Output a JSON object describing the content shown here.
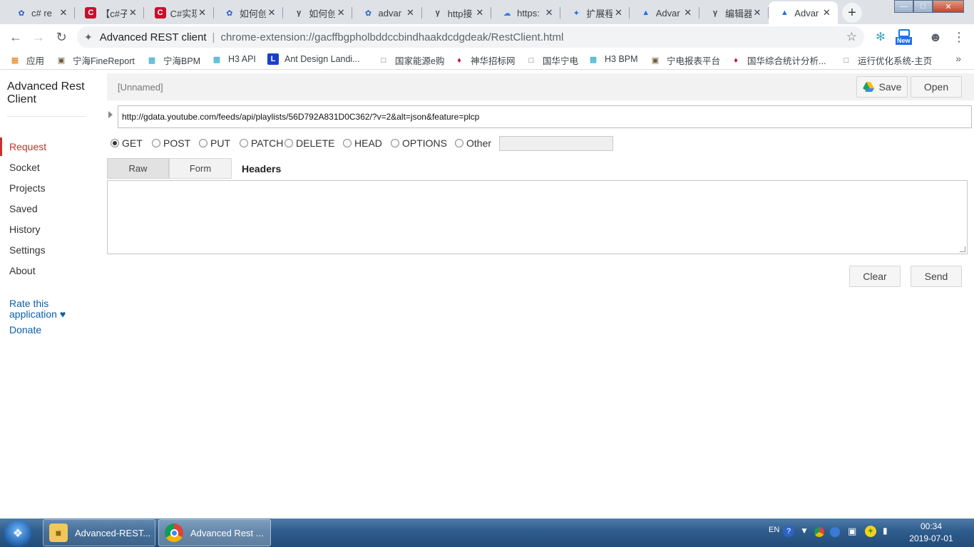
{
  "browser": {
    "tabs": [
      {
        "title": "c# re",
        "icon": "baidu-paw-icon",
        "icon_color": "#2a5dc8",
        "active": false
      },
      {
        "title": "【c#子",
        "icon": "c-logo-icon",
        "icon_color": "#c8102e",
        "active": false
      },
      {
        "title": "C#实现",
        "icon": "c-logo-icon",
        "icon_color": "#c8102e",
        "active": false
      },
      {
        "title": "如何创",
        "icon": "baidu-paw-icon",
        "icon_color": "#2a5dc8",
        "active": false
      },
      {
        "title": "如何创",
        "icon": "jianshu-icon",
        "icon_color": "#444444",
        "active": false
      },
      {
        "title": "advar",
        "icon": "baidu-paw-icon",
        "icon_color": "#2a5dc8",
        "active": false
      },
      {
        "title": "http接",
        "icon": "jianshu-icon",
        "icon_color": "#444444",
        "active": false
      },
      {
        "title": "https:",
        "icon": "cloud-icon",
        "icon_color": "#3b7ddd",
        "active": false
      },
      {
        "title": "扩展程",
        "icon": "puzzle-icon",
        "icon_color": "#1a73e8",
        "active": false
      },
      {
        "title": "Advar",
        "icon": "arc-icon",
        "icon_color": "#1a73e8",
        "active": false
      },
      {
        "title": "编辑器",
        "icon": "jianshu-icon",
        "icon_color": "#444444",
        "active": false
      },
      {
        "title": "Advar",
        "icon": "arc-icon",
        "icon_color": "#1a73e8",
        "active": true
      }
    ],
    "new_tab_label": "+",
    "omnibox": {
      "site": "Advanced REST client",
      "separator": "|",
      "url": "chrome-extension://gacffbgpholbddccbindhaakdcdgdeak/RestClient.html"
    },
    "toolbar_badge": "New",
    "bookmarks": [
      {
        "label": "应用",
        "icon": "apps-grid-icon"
      },
      {
        "label": "宁海FineReport",
        "icon": "report-icon"
      },
      {
        "label": "宁海BPM",
        "icon": "h3-icon"
      },
      {
        "label": "H3 API",
        "icon": "h3-icon"
      },
      {
        "label": "Ant Design Landi...",
        "icon": "l-logo-icon"
      },
      {
        "label": "国家能源e购",
        "icon": "page-icon"
      },
      {
        "label": "神华招标网",
        "icon": "shenhua-icon"
      },
      {
        "label": "国华宁电",
        "icon": "page-icon"
      },
      {
        "label": "H3 BPM",
        "icon": "h3-icon"
      },
      {
        "label": "宁电报表平台",
        "icon": "report-icon"
      },
      {
        "label": "国华综合统计分析...",
        "icon": "shenhua-icon"
      },
      {
        "label": "运行优化系统-主页",
        "icon": "page-icon"
      }
    ],
    "bookmarks_more": "»"
  },
  "app": {
    "title": "Advanced Rest Client",
    "nav": [
      {
        "label": "Request",
        "active": true
      },
      {
        "label": "Socket",
        "active": false
      },
      {
        "label": "Projects",
        "active": false
      },
      {
        "label": "Saved",
        "active": false
      },
      {
        "label": "History",
        "active": false
      },
      {
        "label": "Settings",
        "active": false
      },
      {
        "label": "About",
        "active": false
      }
    ],
    "rate_label": "Rate this application ♥",
    "donate_label": "Donate",
    "request": {
      "name": "[Unnamed]",
      "save_label": "Save",
      "open_label": "Open",
      "url": "http://gdata.youtube.com/feeds/api/playlists/56D792A831D0C362/?v=2&alt=json&feature=plcp",
      "methods": [
        "GET",
        "POST",
        "PUT",
        "PATCH",
        "DELETE",
        "HEAD",
        "OPTIONS",
        "Other"
      ],
      "selected_method": "GET",
      "other_value": "",
      "subtabs": [
        "Raw",
        "Form",
        "Headers"
      ],
      "headers_value": "",
      "clear_label": "Clear",
      "send_label": "Send"
    }
  },
  "taskbar": {
    "items": [
      {
        "label": "Advanced-REST...",
        "icon": "folder-icon"
      },
      {
        "label": "Advanced Rest ...",
        "icon": "chrome-icon"
      }
    ],
    "tray_lang": "EN",
    "time": "00:34",
    "date": "2019-07-01"
  },
  "colors": {
    "accent_red": "#c9302c",
    "link_blue": "#0b5fa9",
    "chrome_tabstrip": "#dee1e6"
  }
}
